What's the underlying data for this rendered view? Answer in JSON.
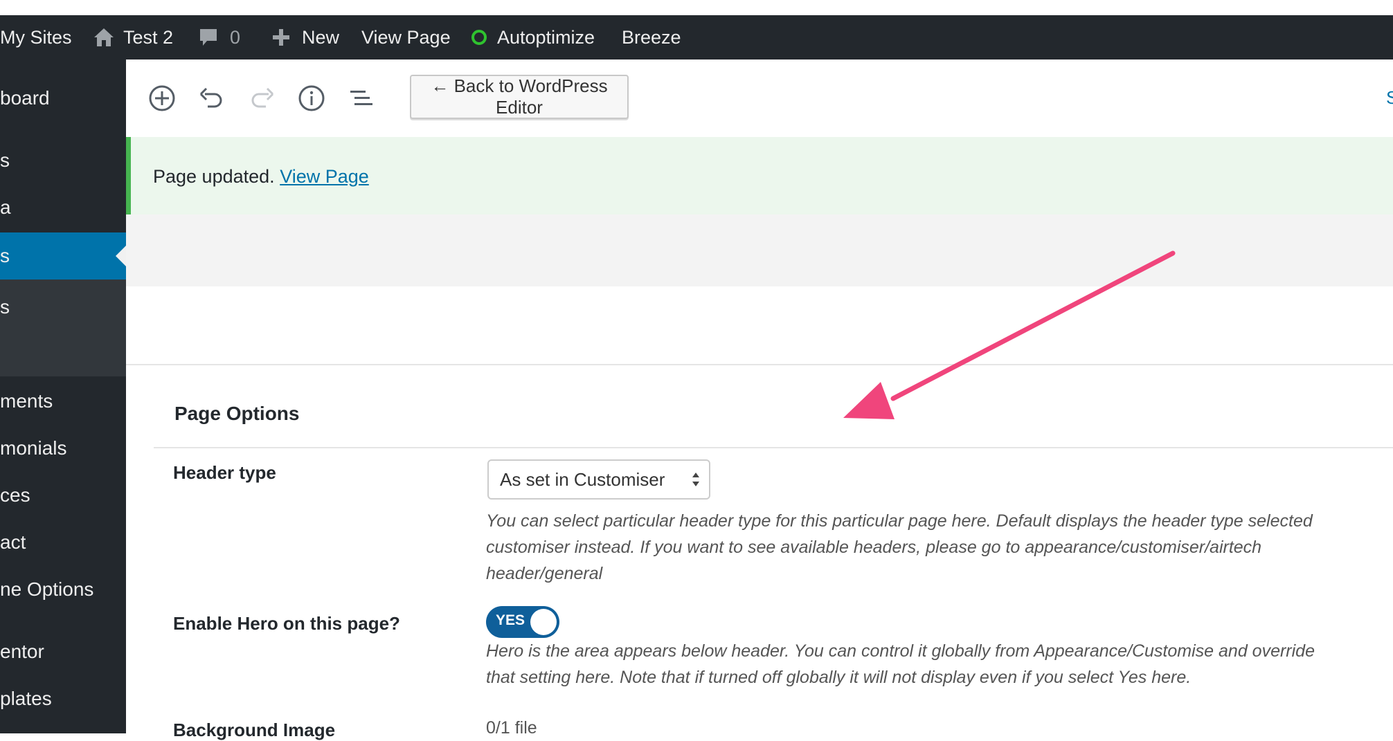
{
  "admin_bar": {
    "my_sites": "My Sites",
    "site_name": "Test 2",
    "comments_count": "0",
    "new_label": "New",
    "view_page": "View Page",
    "autoptimize": "Autoptimize",
    "breeze": "Breeze"
  },
  "sidebar": {
    "items": [
      {
        "label": "board"
      },
      {
        "label": "s"
      },
      {
        "label": "a"
      },
      {
        "label": "s",
        "active": true
      },
      {
        "label": "s"
      },
      {
        "label": "ments"
      },
      {
        "label": "monials"
      },
      {
        "label": "ces"
      },
      {
        "label": "act"
      },
      {
        "label": "ne Options"
      },
      {
        "label": "entor"
      },
      {
        "label": "plates"
      }
    ]
  },
  "toolbar": {
    "back_label": "← Back to WordPress Editor",
    "right_cut": "S"
  },
  "notice": {
    "text": "Page updated.",
    "link": "View Page"
  },
  "page_options": {
    "title": "Page Options",
    "header_type": {
      "label": "Header type",
      "selected": "As set in Customiser",
      "desc_1": "You can select particular header type for this particular page here. Default displays the header type selected",
      "desc_2": "customiser instead. If you want to see available headers, please go to appearance/customiser/airtech",
      "desc_3": "header/general"
    },
    "hero": {
      "label": "Enable Hero on this page?",
      "toggle": "YES",
      "desc_1": "Hero is the area appears below header. You can control it globally from Appearance/Customise and override",
      "desc_2": "that setting here. Note that if turned off globally it will not display even if you select Yes here."
    },
    "background": {
      "label": "Background Image",
      "value": "0/1 file"
    }
  },
  "colors": {
    "admin_bar": "#23282d",
    "accent": "#0073aa",
    "notice_border": "#46b450",
    "arrow": "#f0457c",
    "toggle": "#0f5f9a"
  }
}
